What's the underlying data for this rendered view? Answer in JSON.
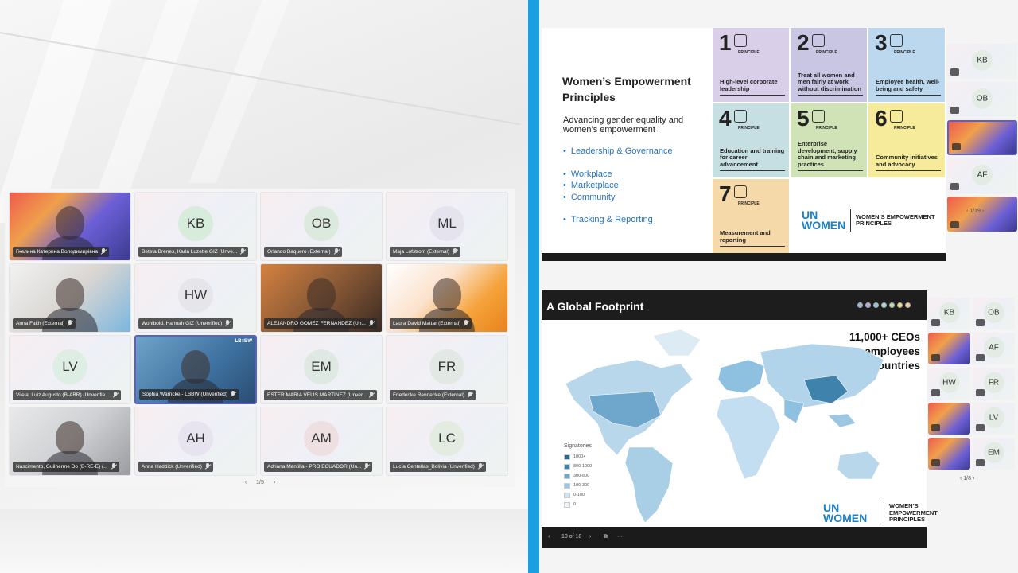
{
  "gallery": {
    "tiles": [
      {
        "name": "Гнелина Катерина Володимирівна",
        "initials": "",
        "video": true
      },
      {
        "name": "Beteta Brenes, Karla Luzette GIZ (Unve...",
        "initials": "KB",
        "avatar_color": "#d8ecdc"
      },
      {
        "name": "Orlando Baquero (External)",
        "initials": "OB",
        "avatar_color": "#dbeadd"
      },
      {
        "name": "Maja Lofstrom (External)",
        "initials": "ML",
        "avatar_color": "#e4e3ee"
      },
      {
        "name": "Anna Falth (External)",
        "initials": "",
        "video": true
      },
      {
        "name": "Wohlbold, Hannah GIZ (Unverified)",
        "initials": "HW",
        "avatar_color": "#e6e6ea"
      },
      {
        "name": "ALEJANDRO GOMEZ FERNANDEZ (Un...",
        "initials": "",
        "video": true
      },
      {
        "name": "Laura David Mattar (External)",
        "initials": "",
        "video": true
      },
      {
        "name": "Vilela, Luiz Augusto (B-ABR) (Unverifie...",
        "initials": "LV",
        "avatar_color": "#dfeee4"
      },
      {
        "name": "Sophia Warncke - LBBW (Unverified)",
        "initials": "",
        "video": true,
        "active": true
      },
      {
        "name": "ESTER MARIA VELIS MARTINEZ (Unver...",
        "initials": "EM",
        "avatar_color": "#dde9e2"
      },
      {
        "name": "Friederike Rennecke (External)",
        "initials": "FR",
        "avatar_color": "#e2e9e4"
      },
      {
        "name": "Nascimento, Guilherme Do (B-RE-E) (...",
        "initials": "",
        "video": true
      },
      {
        "name": "Anna Haddick (Unverified)",
        "initials": "AH",
        "avatar_color": "#e7e4ef"
      },
      {
        "name": "Adriana Mantilla - PRO ECUADOR (Un...",
        "initials": "AM",
        "avatar_color": "#eedfe2"
      },
      {
        "name": "Lucía Centellas_Bolivia (Unverified)",
        "initials": "LC",
        "avatar_color": "#e3ece0"
      }
    ],
    "pager": {
      "prev": "‹",
      "label": "1/5",
      "next": "›"
    },
    "lbbw": "LB≡BW"
  },
  "slide1": {
    "title": "Women’s Empowerment Principles",
    "subtitle": "Advancing gender equality and women’s empowerment :",
    "list": [
      "Leadership & Governance",
      "Workplace",
      "Marketplace",
      "Community",
      "Tracking & Reporting"
    ],
    "principle_word": "PRINCIPLE",
    "principles": [
      {
        "num": "1",
        "text": "High-level corporate leadership",
        "color": "#d9cfe9"
      },
      {
        "num": "2",
        "text": "Treat all women and men fairly at work without discrimination",
        "color": "#c9c6e4"
      },
      {
        "num": "3",
        "text": "Employee health, well-being and safety",
        "color": "#bcd8ef"
      },
      {
        "num": "4",
        "text": "Education and training for career advancement",
        "color": "#c5dfe3"
      },
      {
        "num": "5",
        "text": "Enterprise development, supply chain and marketing practices",
        "color": "#d0e3b7"
      },
      {
        "num": "6",
        "text": "Community initiatives and advocacy",
        "color": "#f6eb9b"
      },
      {
        "num": "7",
        "text": "Measurement and reporting",
        "color": "#f5d9a8"
      }
    ],
    "logo_left": "UN WOMEN",
    "logo_right": "WOMEN’S EMPOWERMENT PRINCIPLES"
  },
  "panel1": {
    "tiles": [
      "KB",
      "OB",
      "",
      "AF",
      ""
    ],
    "pager": "1/19"
  },
  "slide2": {
    "title": "A Global Footprint",
    "stats": [
      "11,000+ CEOs",
      "39 million employees",
      "190 countries"
    ],
    "legend_title": "Signatories",
    "legend": [
      {
        "label": "1000+",
        "color": "#2d6a8f"
      },
      {
        "label": "800-1000",
        "color": "#3f82ab"
      },
      {
        "label": "300-800",
        "color": "#6aa7cc"
      },
      {
        "label": "100-300",
        "color": "#9cc7e2"
      },
      {
        "label": "0-100",
        "color": "#cfe5f2"
      },
      {
        "label": "0",
        "color": "#eef3f7"
      }
    ],
    "logo_left": "UN WOMEN",
    "logo_right": "WOMEN’S EMPOWERMENT PRINCIPLES",
    "page": "10 of 18",
    "prev": "‹",
    "next": "›",
    "more": "···"
  },
  "panel2": {
    "tiles": [
      "KB",
      "OB",
      "",
      "AF",
      "HW",
      "FR",
      "",
      "LV",
      "",
      "EM"
    ],
    "pager": "1/8"
  }
}
